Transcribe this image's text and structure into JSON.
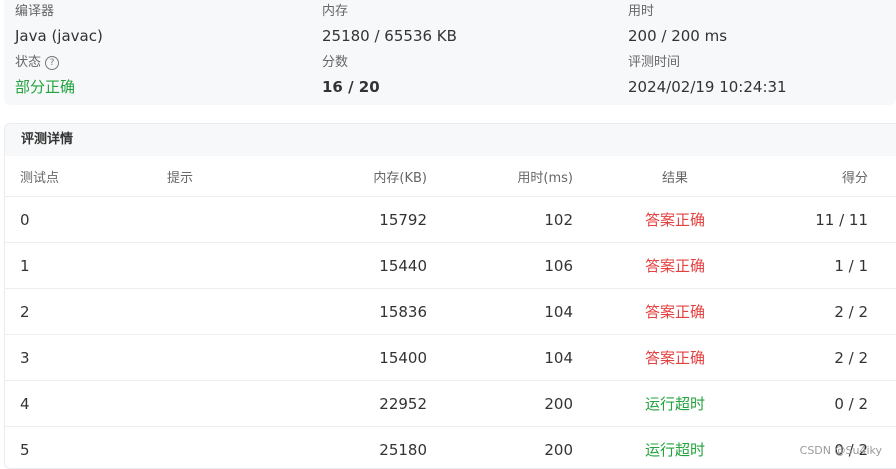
{
  "summary": {
    "compiler_label": "编译器",
    "compiler_value": "Java (javac)",
    "memory_label": "内存",
    "memory_value": "25180 / 65536 KB",
    "time_label": "用时",
    "time_value": "200 / 200 ms",
    "status_label": "状态",
    "status_value": "部分正确",
    "score_label": "分数",
    "score_value": "16 / 20",
    "judge_time_label": "评测时间",
    "judge_time_value": "2024/02/19 10:24:31"
  },
  "details": {
    "title": "评测详情",
    "headers": {
      "id": "测试点",
      "hint": "提示",
      "memory": "内存(KB)",
      "time": "用时(ms)",
      "result": "结果",
      "score": "得分"
    },
    "rows": [
      {
        "id": "0",
        "hint": "",
        "memory": "15792",
        "time": "102",
        "result": "答案正确",
        "score": "11 / 11"
      },
      {
        "id": "1",
        "hint": "",
        "memory": "15440",
        "time": "106",
        "result": "答案正确",
        "score": "1 / 1"
      },
      {
        "id": "2",
        "hint": "",
        "memory": "15836",
        "time": "104",
        "result": "答案正确",
        "score": "2 / 2"
      },
      {
        "id": "3",
        "hint": "",
        "memory": "15400",
        "time": "104",
        "result": "答案正确",
        "score": "2 / 2"
      },
      {
        "id": "4",
        "hint": "",
        "memory": "22952",
        "time": "200",
        "result": "运行超时",
        "score": "0 / 2"
      },
      {
        "id": "5",
        "hint": "",
        "memory": "25180",
        "time": "200",
        "result": "运行超时",
        "score": "0 / 2"
      }
    ]
  },
  "watermark": "CSDN @Su4iky",
  "colors": {
    "accepted": "#e54040",
    "timeout": "#23a33d",
    "partial": "#23a33d"
  }
}
